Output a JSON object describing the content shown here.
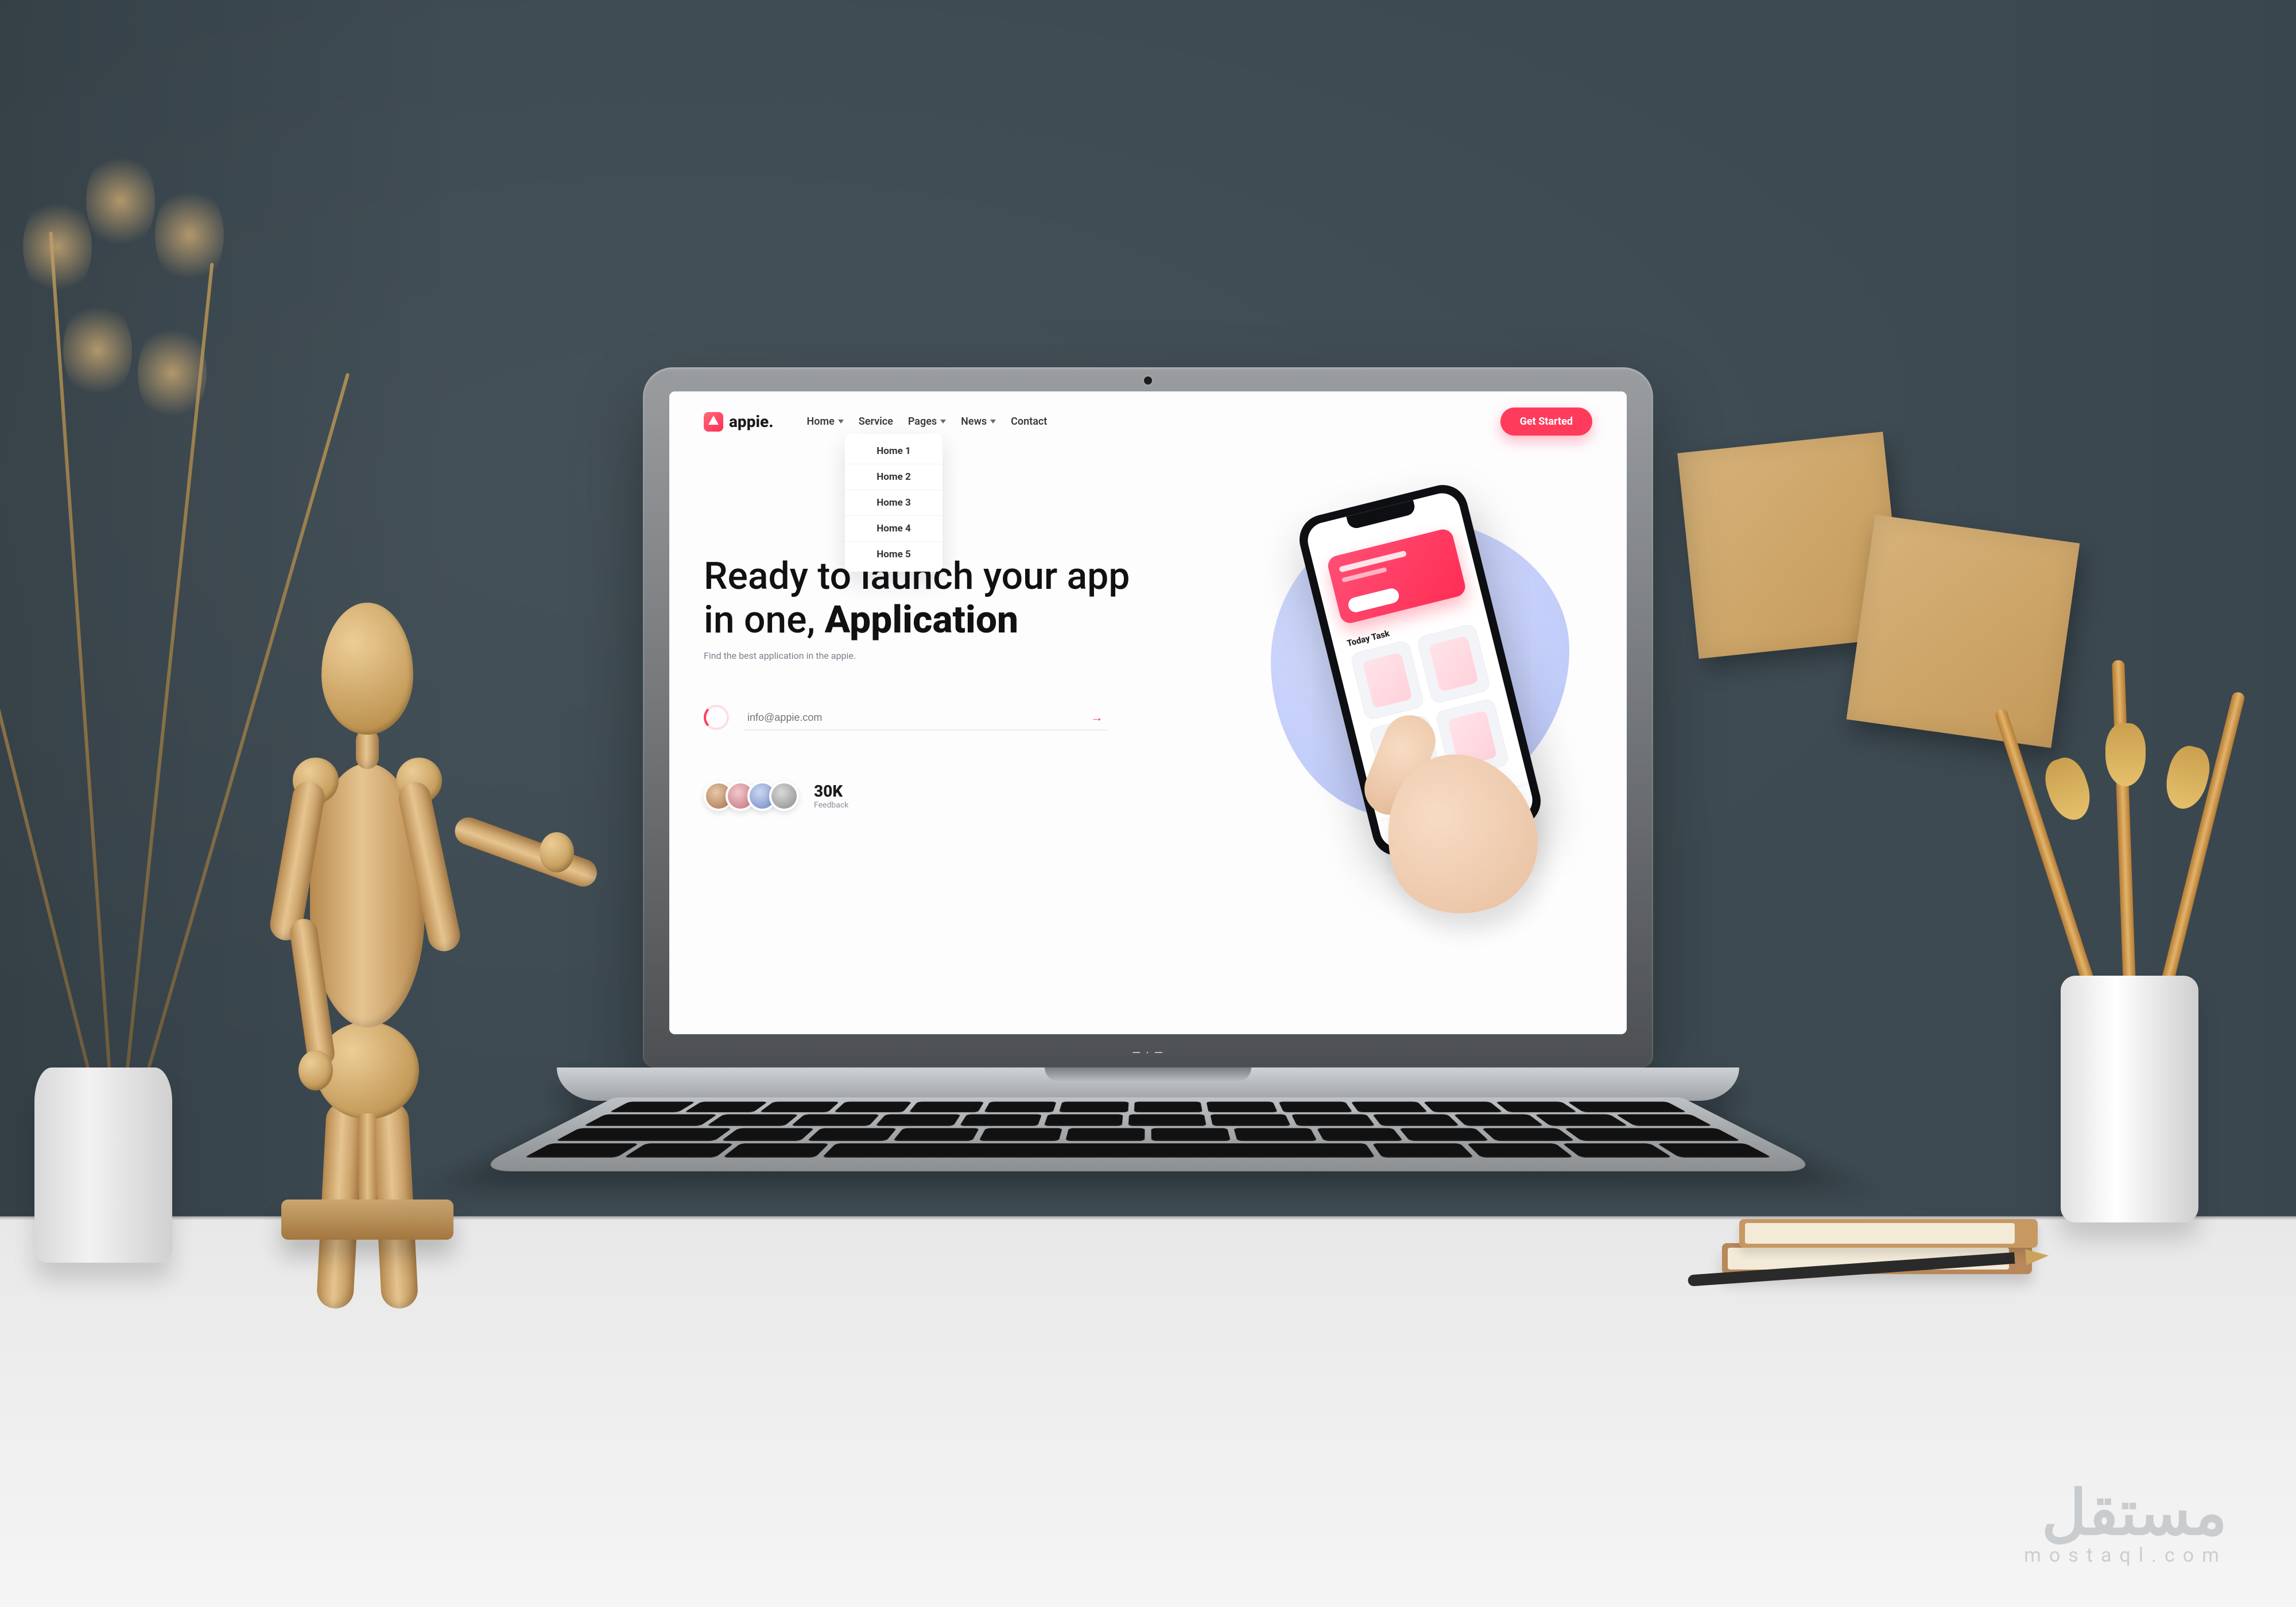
{
  "brand": {
    "name": "appie."
  },
  "nav": {
    "items": [
      {
        "label": "Home",
        "hasDropdown": true
      },
      {
        "label": "Service",
        "hasDropdown": false
      },
      {
        "label": "Pages",
        "hasDropdown": true
      },
      {
        "label": "News",
        "hasDropdown": true
      },
      {
        "label": "Contact",
        "hasDropdown": false
      }
    ],
    "cta": "Get Started",
    "homeDropdown": [
      "Home 1",
      "Home 2",
      "Home 3",
      "Home 4",
      "Home 5"
    ]
  },
  "hero": {
    "line1": "Ready to launch your app",
    "line2_pre": "in one, ",
    "line2_bold": "Application",
    "subtitle": "Find the best application in the appie.",
    "email_placeholder": "info@appie.com",
    "phone_section": "Today Task",
    "feedback_count": "30K",
    "feedback_label": "Feedback"
  },
  "watermark": {
    "ar": "مستقل",
    "en": "mostaql.com"
  }
}
